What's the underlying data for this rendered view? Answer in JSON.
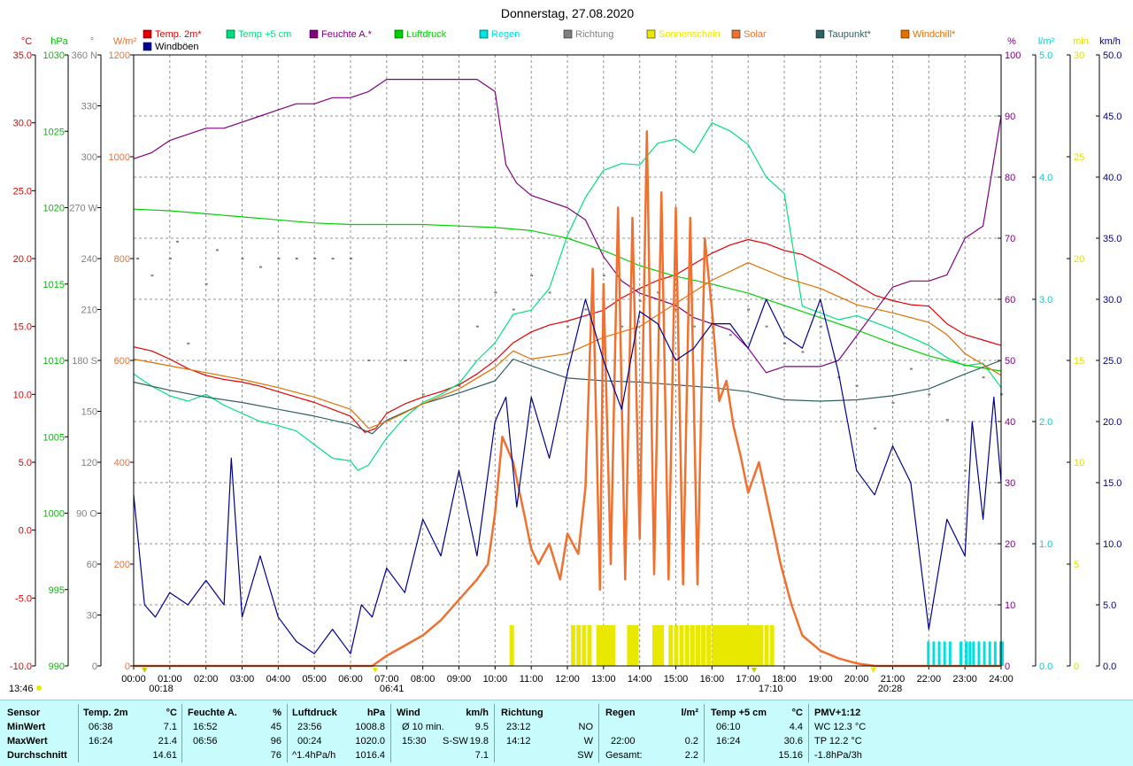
{
  "title": "Donnerstag, 27.08.2020",
  "axes": {
    "temp": {
      "unit": "°C",
      "color": "#e00000",
      "ticks": [
        "35.0",
        "30.0",
        "25.0",
        "20.0",
        "15.0",
        "10.0",
        "5.0",
        "0.0",
        "-5.0",
        "-10.0"
      ]
    },
    "pressure": {
      "unit": "hPa",
      "color": "#00c000",
      "ticks": [
        "1030",
        "1025",
        "1020",
        "1015",
        "1010",
        "1005",
        "1000",
        "995",
        "990"
      ]
    },
    "direction": {
      "unit": "°",
      "color": "#808080",
      "ticks": [
        "360 N",
        "330",
        "300",
        "270 W",
        "240",
        "210",
        "180 S",
        "150",
        "120",
        "90 O",
        "60",
        "30",
        "0"
      ]
    },
    "solar": {
      "unit": "W/m²",
      "color": "#f07030",
      "ticks": [
        "1200",
        "1000",
        "800",
        "600",
        "400",
        "200",
        "0"
      ]
    },
    "humidity": {
      "unit": "%",
      "color": "#800080",
      "ticks": [
        "100",
        "90",
        "80",
        "70",
        "60",
        "50",
        "40",
        "30",
        "20",
        "10",
        "0"
      ]
    },
    "rain": {
      "unit": "l/m²",
      "color": "#00d0d0",
      "ticks": [
        "5.0",
        "4.0",
        "3.0",
        "2.0",
        "1.0",
        "0.0"
      ]
    },
    "sunshine": {
      "unit": "min",
      "color": "#e0e000",
      "ticks": [
        "30",
        "25",
        "20",
        "15",
        "10",
        "5",
        "0"
      ]
    },
    "wind": {
      "unit": "km/h",
      "color": "#000080",
      "ticks": [
        "50.0",
        "45.0",
        "40.0",
        "35.0",
        "30.0",
        "25.0",
        "20.0",
        "15.0",
        "10.0",
        "5.0",
        "0.0"
      ]
    }
  },
  "legend": [
    {
      "label": "Temp. 2m*",
      "color": "#e00000"
    },
    {
      "label": "Temp +5 cm",
      "color": "#00e080"
    },
    {
      "label": "Feuchte A.*",
      "color": "#800080"
    },
    {
      "label": "Luftdruck",
      "color": "#00d000"
    },
    {
      "label": "Regen",
      "color": "#00e0e0"
    },
    {
      "label": "Richtung",
      "color": "#808080"
    },
    {
      "label": "Sonnenschein",
      "color": "#e8e800"
    },
    {
      "label": "Solar",
      "color": "#f07030"
    },
    {
      "label": "Taupunkt*",
      "color": "#306060"
    },
    {
      "label": "Windchill*",
      "color": "#e07000"
    },
    {
      "label": "Windböen",
      "color": "#000090"
    }
  ],
  "x_ticks": [
    "00:00",
    "01:00",
    "02:00",
    "03:00",
    "04:00",
    "05:00",
    "06:00",
    "07:00",
    "08:00",
    "09:00",
    "10:00",
    "11:00",
    "12:00",
    "13:00",
    "14:00",
    "15:00",
    "16:00",
    "17:00",
    "18:00",
    "19:00",
    "20:00",
    "21:00",
    "22:00",
    "23:00",
    "24:00"
  ],
  "markers": {
    "moonrise": "13:46",
    "moonset": "00:18",
    "sunrise": "06:41",
    "suntransit": "17:10",
    "sunset": "20:28"
  },
  "chart_data": {
    "type": "line",
    "title": "Donnerstag, 27.08.2020",
    "x_unit": "hour",
    "xlim": [
      0,
      24
    ],
    "series": [
      {
        "name": "Temp. 2m*",
        "axis": "temp",
        "color": "#e00000",
        "x": [
          0,
          0.5,
          1,
          1.5,
          2,
          2.5,
          3,
          3.5,
          4,
          4.5,
          5,
          5.5,
          6,
          6.4,
          6.7,
          7,
          7.5,
          8,
          8.5,
          9,
          9.5,
          10,
          10.5,
          11,
          11.5,
          12,
          12.5,
          13,
          13.5,
          14,
          14.5,
          15,
          15.5,
          16,
          16.5,
          17,
          17.5,
          18,
          18.5,
          19,
          19.5,
          20,
          20.5,
          21,
          21.5,
          22,
          22.5,
          23,
          23.5,
          24
        ],
        "y": [
          13.5,
          13.2,
          12.6,
          11.9,
          11.4,
          11.1,
          10.9,
          10.6,
          10.2,
          9.8,
          9.4,
          8.9,
          8.4,
          7.2,
          7.5,
          8.6,
          9.3,
          9.8,
          10.2,
          10.7,
          11.5,
          12.5,
          13.8,
          14.6,
          15.1,
          15.4,
          15.8,
          16.2,
          17.1,
          17.8,
          18.4,
          18.8,
          19.6,
          20.4,
          21.0,
          21.4,
          21.1,
          20.6,
          20.3,
          19.6,
          18.9,
          18.1,
          17.3,
          16.9,
          16.6,
          16.5,
          15.2,
          14.4,
          14.0,
          13.6
        ]
      },
      {
        "name": "Temp +5 cm",
        "axis": "temp",
        "color": "#00e080",
        "x": [
          0,
          0.5,
          1,
          1.5,
          2,
          2.5,
          3,
          3.5,
          4,
          4.5,
          5,
          5.5,
          6,
          6.2,
          6.5,
          7,
          7.5,
          8,
          8.5,
          9,
          9.5,
          10,
          10.5,
          11,
          11.5,
          12,
          12.5,
          13,
          13.5,
          14,
          14.5,
          15,
          15.5,
          16,
          16.5,
          17,
          17.5,
          18,
          18.5,
          19,
          19.5,
          20,
          20.5,
          21,
          21.5,
          22,
          22.5,
          23,
          23.5,
          24
        ],
        "y": [
          11.5,
          10.6,
          9.9,
          9.5,
          10.0,
          9.2,
          8.6,
          8.0,
          7.7,
          7.3,
          6.3,
          5.3,
          5.1,
          4.4,
          4.8,
          6.8,
          8.3,
          9.4,
          10.0,
          10.8,
          12.5,
          13.8,
          15.9,
          16.2,
          17.8,
          21.7,
          24.5,
          26.5,
          27.0,
          26.9,
          28.5,
          28.8,
          27.8,
          30.0,
          29.4,
          28.4,
          26.0,
          24.8,
          16.5,
          16.0,
          15.5,
          15.8,
          15.3,
          14.8,
          14.2,
          13.6,
          12.7,
          12.1,
          12.3,
          10.5
        ]
      },
      {
        "name": "Feuchte A.*",
        "axis": "humidity",
        "color": "#800080",
        "x": [
          0,
          0.5,
          1,
          1.5,
          2,
          2.5,
          3,
          3.5,
          4,
          4.5,
          5,
          5.5,
          6,
          6.5,
          7,
          7.5,
          8,
          8.5,
          9,
          9.5,
          10,
          10.3,
          10.6,
          11,
          11.5,
          12,
          12.5,
          13,
          13.5,
          14,
          14.5,
          15,
          15.5,
          16,
          16.5,
          17,
          17.5,
          18,
          18.5,
          19,
          19.5,
          20,
          20.5,
          21,
          21.5,
          22,
          22.5,
          23,
          23.5,
          24
        ],
        "y": [
          83,
          84,
          86,
          87,
          88,
          88,
          89,
          90,
          91,
          92,
          92,
          93,
          93,
          94,
          96,
          96,
          96,
          96,
          96,
          96,
          94,
          82,
          79,
          77,
          76,
          75,
          73,
          67,
          63,
          61,
          60,
          59,
          57,
          56,
          55,
          52,
          48,
          49,
          49,
          49,
          50,
          54,
          58,
          62,
          63,
          63,
          64,
          70,
          72,
          90
        ]
      },
      {
        "name": "Luftdruck",
        "axis": "pressure",
        "color": "#00d000",
        "x": [
          0,
          1,
          2,
          3,
          4,
          5,
          6,
          7,
          8,
          9,
          10,
          11,
          12,
          13,
          14,
          15,
          16,
          17,
          18,
          19,
          20,
          21,
          22,
          23,
          24
        ],
        "y": [
          1019.9,
          1019.8,
          1019.6,
          1019.4,
          1019.2,
          1019.0,
          1018.9,
          1018.9,
          1018.9,
          1018.8,
          1018.7,
          1018.5,
          1018.0,
          1017.2,
          1016.2,
          1015.5,
          1015.0,
          1014.4,
          1013.6,
          1012.8,
          1012.0,
          1011.1,
          1010.3,
          1009.7,
          1009.3
        ]
      },
      {
        "name": "Taupunkt*",
        "axis": "temp",
        "color": "#306060",
        "x": [
          0,
          1,
          2,
          3,
          4,
          5,
          6,
          6.6,
          7,
          8,
          9,
          10,
          10.5,
          11,
          12,
          13,
          14,
          15,
          16,
          17,
          18,
          19,
          20,
          21,
          22,
          23,
          24
        ],
        "y": [
          10.9,
          10.3,
          9.8,
          9.4,
          8.9,
          8.4,
          7.8,
          7.1,
          8.1,
          9.3,
          10.1,
          11.0,
          12.6,
          12.1,
          11.2,
          11.0,
          10.9,
          10.7,
          10.5,
          10.2,
          9.6,
          9.5,
          9.6,
          9.9,
          10.4,
          11.5,
          12.5
        ]
      },
      {
        "name": "Windchill*",
        "axis": "temp",
        "color": "#e07000",
        "x": [
          0,
          1,
          2,
          3,
          4,
          5,
          6,
          6.5,
          7,
          8,
          9,
          10,
          10.5,
          11,
          12,
          13,
          14,
          15,
          16,
          17,
          18,
          19,
          20,
          21,
          22,
          22.5,
          23,
          23.5,
          24
        ],
        "y": [
          12.6,
          12.1,
          11.6,
          11.1,
          10.5,
          9.8,
          8.9,
          7.5,
          8.0,
          9.3,
          10.4,
          12.0,
          13.2,
          12.6,
          13.0,
          14.2,
          15.0,
          16.7,
          18.4,
          19.7,
          18.6,
          17.8,
          16.6,
          16.0,
          15.3,
          14.4,
          13.0,
          12.2,
          11.4
        ]
      },
      {
        "name": "Solar",
        "axis": "solar",
        "color": "#f07030",
        "x": [
          0,
          6.6,
          7,
          7.5,
          8,
          8.5,
          9,
          9.5,
          9.8,
          10,
          10.2,
          10.5,
          10.8,
          11,
          11.2,
          11.5,
          11.8,
          12,
          12.3,
          12.5,
          12.7,
          12.9,
          13,
          13.2,
          13.4,
          13.6,
          13.8,
          14,
          14.2,
          14.4,
          14.6,
          14.8,
          15,
          15.2,
          15.4,
          15.6,
          15.8,
          16,
          16.2,
          16.4,
          16.6,
          16.8,
          17,
          17.3,
          17.6,
          17.9,
          18.2,
          18.5,
          19,
          19.5,
          20,
          20.5,
          21,
          24
        ],
        "y": [
          0,
          0,
          20,
          40,
          60,
          90,
          130,
          170,
          200,
          300,
          450,
          400,
          300,
          230,
          200,
          240,
          170,
          260,
          220,
          350,
          780,
          150,
          750,
          200,
          900,
          170,
          880,
          250,
          1050,
          180,
          930,
          170,
          900,
          160,
          880,
          160,
          840,
          700,
          520,
          560,
          470,
          410,
          340,
          400,
          300,
          200,
          120,
          60,
          30,
          15,
          5,
          0,
          0,
          0
        ]
      },
      {
        "name": "Windböen",
        "axis": "wind",
        "color": "#000090",
        "x": [
          0,
          0.3,
          0.6,
          1,
          1.5,
          2,
          2.5,
          2.7,
          3,
          3.5,
          4,
          4.5,
          5,
          5.5,
          6,
          6.3,
          6.6,
          7,
          7.5,
          8,
          8.5,
          9,
          9.5,
          10,
          10.3,
          10.6,
          11,
          11.5,
          12,
          12.5,
          13,
          13.5,
          14,
          14.5,
          15,
          15.5,
          16,
          16.5,
          17,
          17.5,
          18,
          18.5,
          19,
          19.5,
          20,
          20.5,
          21,
          21.5,
          22,
          22.5,
          23,
          23.2,
          23.5,
          23.8,
          24
        ],
        "y": [
          14,
          5,
          4,
          6,
          5,
          7,
          5,
          17,
          4,
          9,
          4,
          2,
          1,
          3,
          1,
          5,
          4,
          8,
          6,
          12,
          9,
          16,
          9,
          20,
          22,
          13,
          22,
          17,
          24,
          30,
          25,
          21,
          29,
          28,
          25,
          26,
          28,
          28,
          26,
          30,
          27,
          26,
          30,
          24,
          16,
          14,
          18,
          15,
          3,
          12,
          9,
          20,
          12,
          22,
          15
        ]
      }
    ],
    "sunshine": {
      "axis": "sunshine",
      "color": "#e8e800",
      "x": [
        10.4,
        12.1,
        12.25,
        12.4,
        12.55,
        12.8,
        12.9,
        13.0,
        13.1,
        13.2,
        13.65,
        13.75,
        13.85,
        14.35,
        14.45,
        14.55,
        14.8,
        14.95,
        15.1,
        15.25,
        15.4,
        15.55,
        15.7,
        15.85,
        16.0,
        16.1,
        16.2,
        16.3,
        16.4,
        16.5,
        16.6,
        16.7,
        16.8,
        16.9,
        17.0,
        17.1,
        17.2,
        17.3,
        17.45,
        17.6
      ],
      "y": [
        2,
        2,
        2,
        2,
        2,
        2,
        2,
        2,
        2,
        2,
        2,
        2,
        2,
        2,
        2,
        2,
        2,
        2,
        2,
        2,
        2,
        2,
        2,
        2,
        2,
        2,
        2,
        2,
        2,
        2,
        2,
        2,
        2,
        2,
        2,
        2,
        2,
        2,
        2,
        2
      ]
    },
    "rain": {
      "axis": "rain",
      "color": "#00e0e0",
      "x": [
        21.95,
        22.1,
        22.25,
        22.4,
        22.55,
        22.85,
        23.0,
        23.1,
        23.2,
        23.35,
        23.5,
        23.65,
        23.8,
        23.95,
        24
      ],
      "y": [
        0.2,
        0.2,
        0.2,
        0.2,
        0.2,
        0.2,
        0.2,
        0.2,
        0.2,
        0.2,
        0.2,
        0.2,
        0.2,
        0.2,
        0.2
      ]
    },
    "direction": {
      "axis": "direction",
      "color": "#808080",
      "x": [
        0.1,
        0.5,
        1,
        1.2,
        1.5,
        2,
        2.3,
        3,
        3.5,
        4,
        4.5,
        5,
        5.5,
        6,
        6.5,
        7.5,
        8,
        9,
        9.5,
        10,
        10.5,
        11,
        11.5,
        12,
        12.5,
        13,
        13.5,
        14,
        14.5,
        15,
        15.5,
        16,
        16.5,
        17,
        17.5,
        18,
        18.5,
        19,
        19.5,
        20,
        20.5,
        21,
        21.5,
        22,
        22.5,
        23,
        23.5,
        24
      ],
      "y": [
        240,
        230,
        240,
        250,
        190,
        225,
        245,
        240,
        235,
        240,
        240,
        240,
        240,
        240,
        180,
        180,
        160,
        165,
        200,
        220,
        210,
        230,
        220,
        200,
        210,
        230,
        200,
        215,
        220,
        210,
        200,
        205,
        195,
        210,
        200,
        190,
        185,
        200,
        170,
        165,
        140,
        155,
        175,
        160,
        145,
        115,
        170,
        160
      ]
    }
  },
  "stats": {
    "headers": {
      "sensor": "Sensor",
      "temp": "Temp. 2m",
      "temp_unit": "°C",
      "hum": "Feuchte A.",
      "hum_unit": "%",
      "press": "Luftdruck",
      "press_unit": "hPa",
      "wind": "Wind",
      "wind_unit": "km/h",
      "dir": "Richtung",
      "rain": "Regen",
      "rain_unit": "l/m²",
      "t5": "Temp +5 cm",
      "t5_unit": "°C",
      "pmv": "PMV+1:12"
    },
    "rows": {
      "min": "MinWert",
      "max": "MaxWert",
      "avg": "Durchschnitt"
    },
    "temp": {
      "min_t": "06:38",
      "min_v": "7.1",
      "max_t": "16:24",
      "max_v": "21.4",
      "avg": "14.61"
    },
    "hum": {
      "min_t": "16:52",
      "min_v": "45",
      "max_t": "06:56",
      "max_v": "96",
      "avg": "76"
    },
    "press": {
      "min_t": "23:56",
      "min_v": "1008.8",
      "max_t": "00:24",
      "max_v": "1020.0",
      "trend": "^1.4hPa/h",
      "avg": "1016.4"
    },
    "wind": {
      "avg_label": "Ø 10 min.",
      "avg_v": "9.5",
      "max_t": "15:30",
      "max_dir": "S-SW",
      "max_v": "19.8",
      "avg": "7.1"
    },
    "dir": {
      "t1": "23:12",
      "d1": "NO",
      "t2": "14:12",
      "d2": "W",
      "avg": "SW"
    },
    "rain": {
      "t": "22:00",
      "v": "0.2",
      "total_label": "Gesamt:",
      "total": "2.2"
    },
    "t5": {
      "min_t": "06:10",
      "min_v": "4.4",
      "max_t": "16:24",
      "max_v": "30.6",
      "avg": "15.16"
    },
    "pmv": {
      "wc": "WC 12.3 °C",
      "tp": "TP 12.2 °C",
      "trend": "-1.8hPa/3h"
    }
  }
}
